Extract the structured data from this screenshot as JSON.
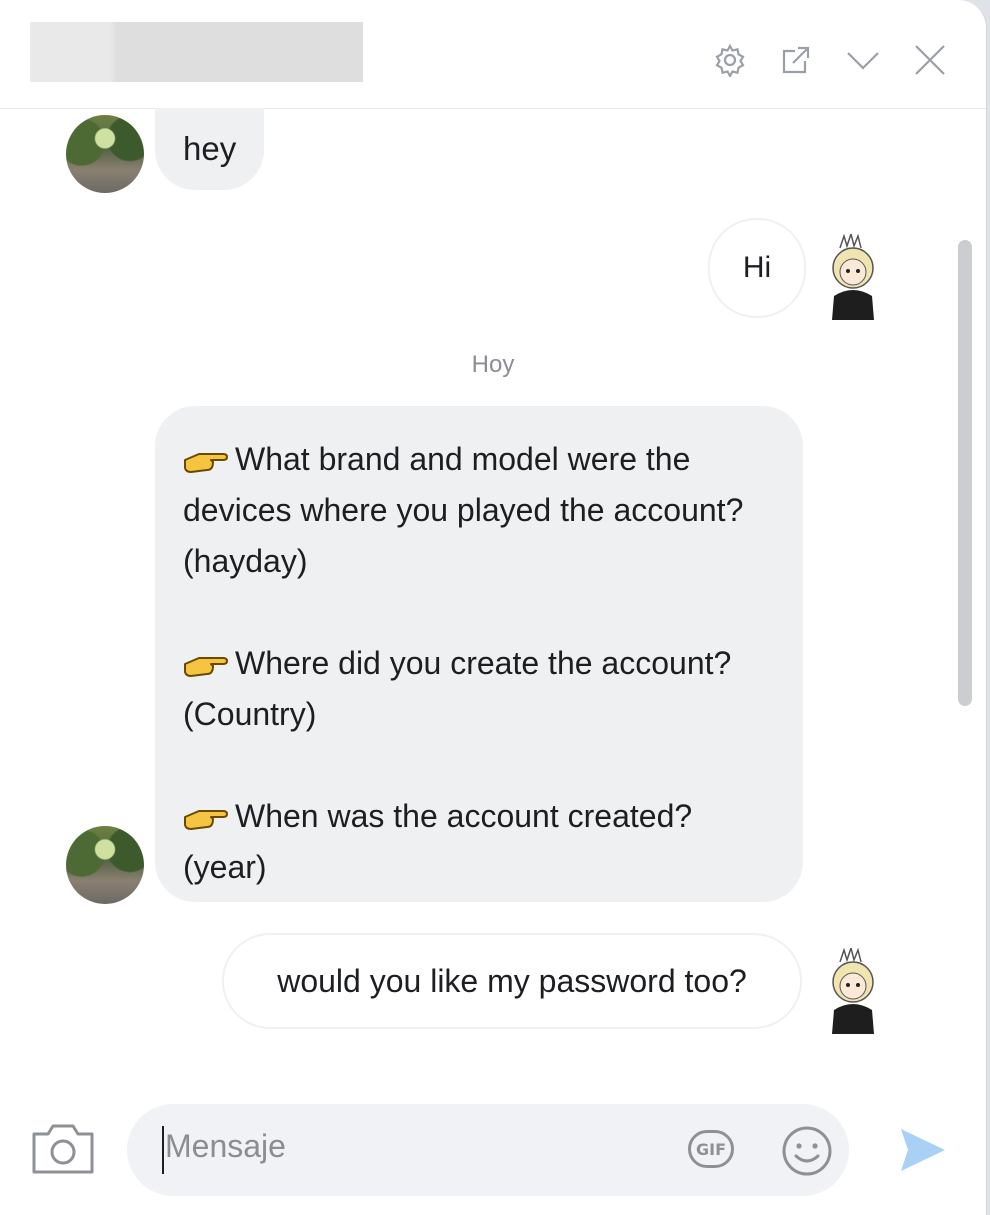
{
  "header": {
    "contact_name": "",
    "icons": [
      "gear-icon",
      "open-external-icon",
      "chevron-down-icon",
      "close-icon"
    ]
  },
  "messages": [
    {
      "direction": "incoming",
      "text": "hey"
    },
    {
      "direction": "outgoing",
      "text": "Hi"
    },
    {
      "separator": "Hoy"
    },
    {
      "direction": "incoming",
      "paragraphs": [
        "What brand and model were the devices where you played the account?(hayday)",
        "Where did you create the account? (Country)",
        "When was the account created? (year)"
      ],
      "bullet_icon": "pointing-hand-icon"
    },
    {
      "direction": "outgoing",
      "text": "would you like my password too?"
    }
  ],
  "composer": {
    "placeholder": "Mensaje",
    "gif_label": "GIF",
    "icons": [
      "camera-icon",
      "gif-icon",
      "emoji-icon",
      "send-icon"
    ]
  },
  "colors": {
    "incoming_bubble": "#eef0f2",
    "send_button": "#a8d1f5",
    "icon_gray": "#9aa0a6"
  }
}
